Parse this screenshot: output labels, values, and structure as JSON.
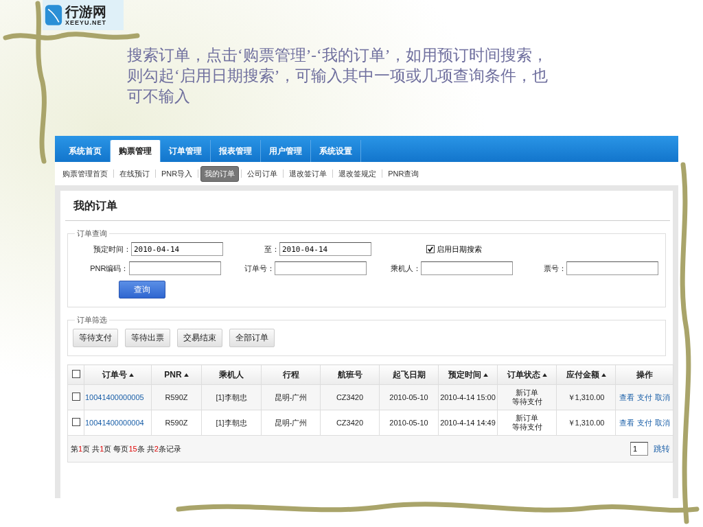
{
  "logo": {
    "name": "行游网",
    "domain": "XEEYU.NET"
  },
  "caption": "搜索订单，点击‘购票管理’-‘我的订单’，如用预订时间搜索，则勾起‘启用日期搜索’，可输入其中一项或几项查询条件，也可不输入",
  "nav": {
    "tabs": [
      {
        "label": "系统首页",
        "selected": false
      },
      {
        "label": "购票管理",
        "selected": true
      },
      {
        "label": "订单管理",
        "selected": false
      },
      {
        "label": "报表管理",
        "selected": false
      },
      {
        "label": "用户管理",
        "selected": false
      },
      {
        "label": "系统设置",
        "selected": false
      }
    ]
  },
  "subnav": {
    "items": [
      {
        "label": "购票管理首页",
        "selected": false
      },
      {
        "label": "在线预订",
        "selected": false
      },
      {
        "label": "PNR导入",
        "selected": false
      },
      {
        "label": "我的订单",
        "selected": true
      },
      {
        "label": "公司订单",
        "selected": false
      },
      {
        "label": "退改签订单",
        "selected": false
      },
      {
        "label": "退改签规定",
        "selected": false
      },
      {
        "label": "PNR查询",
        "selected": false
      }
    ]
  },
  "panel": {
    "title": "我的订单"
  },
  "query": {
    "legend": "订单查询",
    "rows": [
      [
        {
          "label": "预定时间：",
          "value": "2010-04-14"
        },
        {
          "label": "至：",
          "value": "2010-04-14"
        }
      ],
      [
        {
          "label": "PNR编码："
        },
        {
          "label": "订单号："
        },
        {
          "label": "乘机人："
        },
        {
          "label": "票号："
        }
      ]
    ],
    "date_search": {
      "label": "启用日期搜索",
      "checked": true
    },
    "button": "查询"
  },
  "filter": {
    "legend": "订单筛选",
    "buttons": [
      "等待支付",
      "等待出票",
      "交易结束",
      "全部订单"
    ]
  },
  "table": {
    "select_all": false,
    "columns": [
      {
        "label": "订单号",
        "sortable": true
      },
      {
        "label": "PNR",
        "sortable": true
      },
      {
        "label": "乘机人",
        "sortable": false
      },
      {
        "label": "行程",
        "sortable": false
      },
      {
        "label": "航班号",
        "sortable": false
      },
      {
        "label": "起飞日期",
        "sortable": false
      },
      {
        "label": "预定时间",
        "sortable": true
      },
      {
        "label": "订单状态",
        "sortable": true
      },
      {
        "label": "应付金额",
        "sortable": true
      },
      {
        "label": "操作",
        "sortable": false
      }
    ],
    "rows": [
      {
        "checked": false,
        "order": "10041400000005",
        "pnr": "R590Z",
        "passenger": "[1]李朝忠",
        "route": "昆明-广州",
        "flight": "CZ3420",
        "date": "2010-05-10",
        "booked": "2010-4-14 15:00",
        "status": [
          "新订单",
          "等待支付"
        ],
        "amount": "￥1,310.00",
        "actions": [
          "查看",
          "支付",
          "取消"
        ]
      },
      {
        "checked": false,
        "order": "10041400000004",
        "pnr": "R590Z",
        "passenger": "[1]李朝忠",
        "route": "昆明-广州",
        "flight": "CZ3420",
        "date": "2010-05-10",
        "booked": "2010-4-14 14:49",
        "status": [
          "新订单",
          "等待支付"
        ],
        "amount": "￥1,310.00",
        "actions": [
          "查看",
          "支付",
          "取消"
        ]
      }
    ]
  },
  "pager": {
    "segments": [
      {
        "text": "第",
        "highlight": false
      },
      {
        "text": "1",
        "highlight": true
      },
      {
        "text": "页 共",
        "highlight": false
      },
      {
        "text": "1",
        "highlight": true
      },
      {
        "text": "页 每页",
        "highlight": false
      },
      {
        "text": "15",
        "highlight": true
      },
      {
        "text": "条 共",
        "highlight": false
      },
      {
        "text": "2",
        "highlight": true
      },
      {
        "text": "条记录",
        "highlight": false
      }
    ],
    "page": "1",
    "jump": "跳转"
  }
}
